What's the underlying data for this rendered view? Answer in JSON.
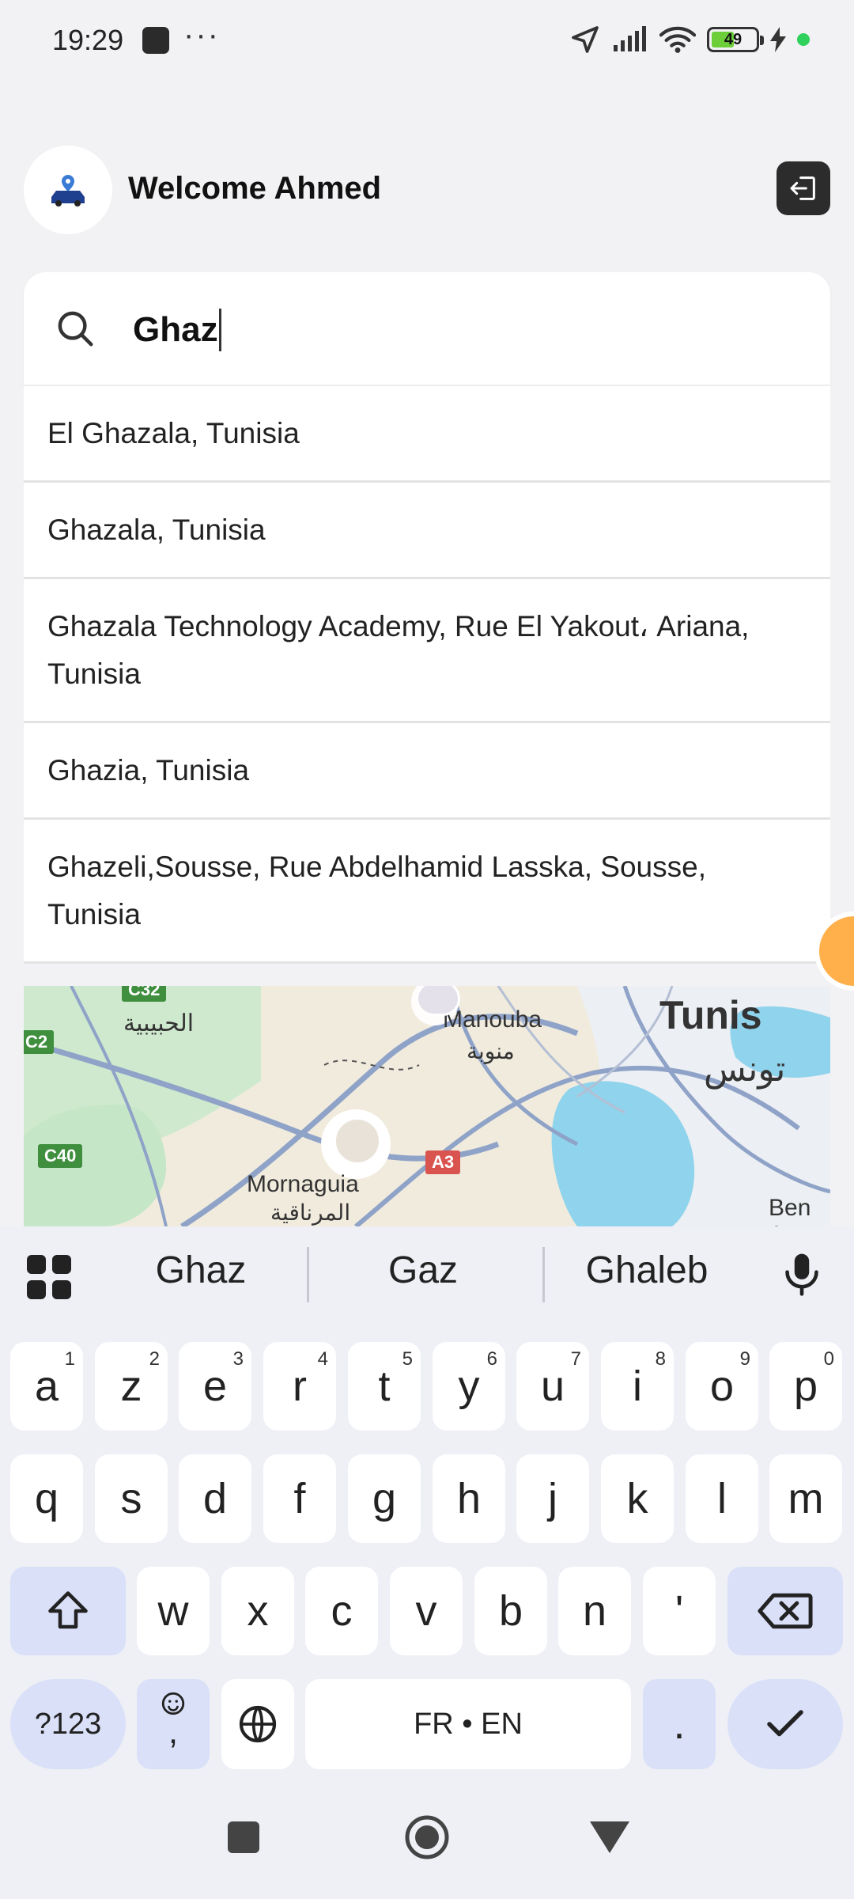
{
  "status_bar": {
    "time": "19:29",
    "battery": "49"
  },
  "header": {
    "welcome": "Welcome Ahmed"
  },
  "search": {
    "value": "Ghaz"
  },
  "suggestions": [
    "El Ghazala, Tunisia",
    "Ghazala, Tunisia",
    "Ghazala Technology Academy, Rue El Yakout، Ariana, Tunisia",
    "Ghazia, Tunisia",
    "Ghazeli,Sousse, Rue Abdelhamid Lasska, Sousse, Tunisia"
  ],
  "map": {
    "labels": {
      "tunis": "Tunis",
      "tunis_ar": "تونس",
      "manouba": "Manouba",
      "manouba_ar": "منوبة",
      "mornaguia": "Mornaguia",
      "mornaguia_ar": "المرناقية",
      "habibia_ar": "الحبيبية",
      "ben_arous": "Ben A",
      "c40": "C40",
      "a3": "A3",
      "c32": "C32",
      "c2": "C2"
    }
  },
  "keyboard": {
    "suggestions": [
      "Ghaz",
      "Gaz",
      "Ghaleb"
    ],
    "row1": [
      [
        "a",
        "1"
      ],
      [
        "z",
        "2"
      ],
      [
        "e",
        "3"
      ],
      [
        "r",
        "4"
      ],
      [
        "t",
        "5"
      ],
      [
        "y",
        "6"
      ],
      [
        "u",
        "7"
      ],
      [
        "i",
        "8"
      ],
      [
        "o",
        "9"
      ],
      [
        "p",
        "0"
      ]
    ],
    "row2": [
      "q",
      "s",
      "d",
      "f",
      "g",
      "h",
      "j",
      "k",
      "l",
      "m"
    ],
    "row3": [
      "w",
      "x",
      "c",
      "v",
      "b",
      "n",
      "'"
    ],
    "symbols": "?123",
    "emoji_comma": ",",
    "space": "FR • EN",
    "period": "."
  }
}
